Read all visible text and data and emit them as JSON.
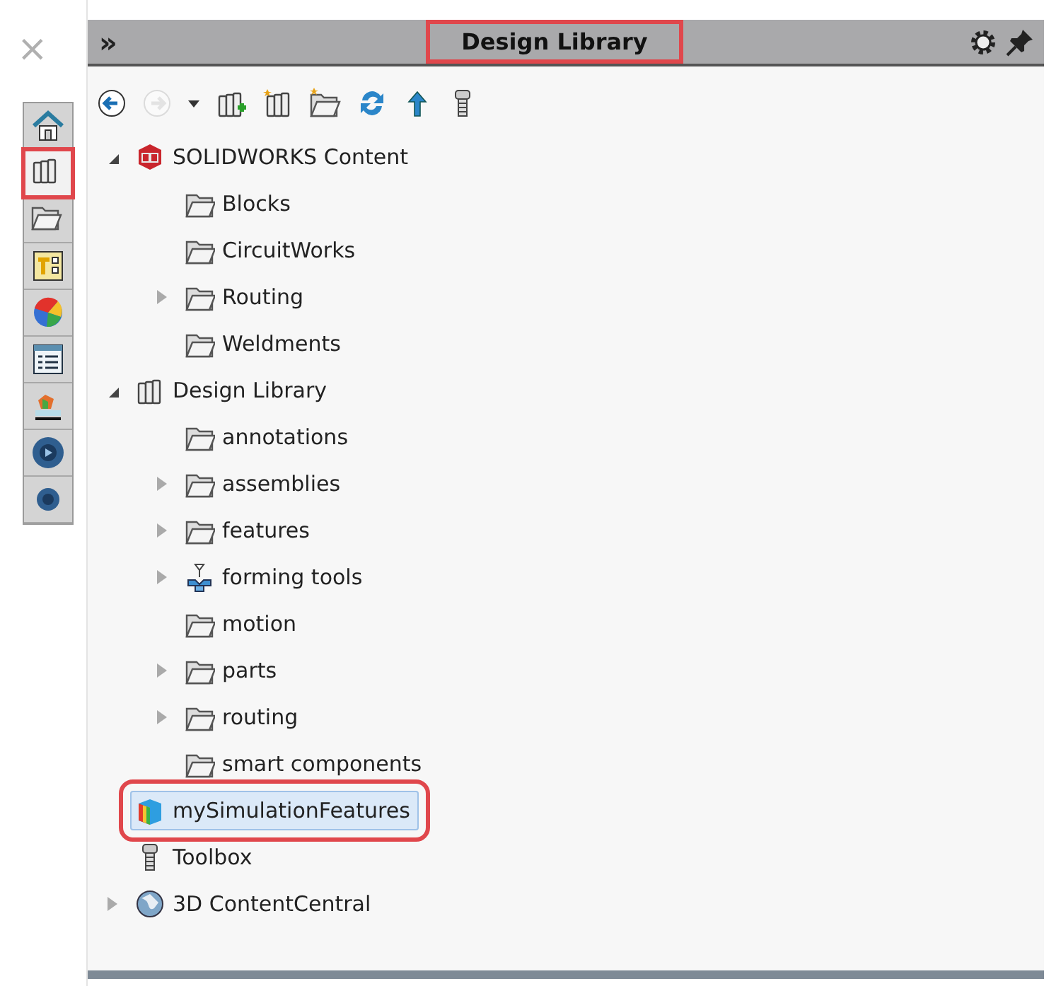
{
  "close_glyph": "×",
  "sidebar_tabs": [
    {
      "kind": "home",
      "selected": false,
      "highlighted": false
    },
    {
      "kind": "library",
      "selected": true,
      "highlighted": true
    },
    {
      "kind": "folder",
      "selected": false,
      "highlighted": false
    },
    {
      "kind": "layout",
      "selected": false,
      "highlighted": false
    },
    {
      "kind": "ball",
      "selected": false,
      "highlighted": false
    },
    {
      "kind": "list",
      "selected": false,
      "highlighted": false
    },
    {
      "kind": "scene",
      "selected": false,
      "highlighted": false
    },
    {
      "kind": "disc",
      "selected": false,
      "highlighted": false
    },
    {
      "kind": "small-disc",
      "selected": false,
      "highlighted": false
    }
  ],
  "panel": {
    "expand_glyph": "»",
    "title": "Design Library",
    "title_highlighted": true,
    "toolbar": [
      {
        "kind": "back",
        "disabled": false
      },
      {
        "kind": "forward",
        "disabled": true
      },
      {
        "kind": "caret",
        "disabled": false
      },
      {
        "kind": "add-library",
        "disabled": false
      },
      {
        "kind": "new-library",
        "disabled": false
      },
      {
        "kind": "new-folder",
        "disabled": false
      },
      {
        "kind": "refresh",
        "disabled": false
      },
      {
        "kind": "up",
        "disabled": false
      },
      {
        "kind": "bolt",
        "disabled": false
      }
    ],
    "tree": [
      {
        "label": "SOLIDWORKS Content",
        "kind": "sw",
        "expanded": true,
        "selected": false,
        "highlighted": false,
        "children": [
          {
            "label": "Blocks",
            "kind": "folder",
            "selected": false,
            "highlighted": false
          },
          {
            "label": "CircuitWorks",
            "kind": "folder",
            "selected": false,
            "highlighted": false
          },
          {
            "label": "Routing",
            "kind": "folder",
            "expanded": false,
            "selected": false,
            "highlighted": false
          },
          {
            "label": "Weldments",
            "kind": "folder",
            "selected": false,
            "highlighted": false
          }
        ]
      },
      {
        "label": "Design Library",
        "kind": "library",
        "expanded": true,
        "selected": false,
        "highlighted": false,
        "children": [
          {
            "label": "annotations",
            "kind": "folder",
            "selected": false,
            "highlighted": false
          },
          {
            "label": "assemblies",
            "kind": "folder",
            "expanded": false,
            "selected": false,
            "highlighted": false
          },
          {
            "label": "features",
            "kind": "folder",
            "expanded": false,
            "selected": false,
            "highlighted": false
          },
          {
            "label": "forming tools",
            "kind": "forming",
            "expanded": false,
            "selected": false,
            "highlighted": false
          },
          {
            "label": "motion",
            "kind": "folder",
            "selected": false,
            "highlighted": false
          },
          {
            "label": "parts",
            "kind": "folder",
            "expanded": false,
            "selected": false,
            "highlighted": false
          },
          {
            "label": "routing",
            "kind": "folder",
            "expanded": false,
            "selected": false,
            "highlighted": false
          },
          {
            "label": "smart components",
            "kind": "folder",
            "selected": false,
            "highlighted": false
          }
        ]
      },
      {
        "label": "mySimulationFeatures",
        "kind": "simulation",
        "selected": true,
        "highlighted": true
      },
      {
        "label": "Toolbox",
        "kind": "toolbox",
        "selected": false,
        "highlighted": false
      },
      {
        "label": "3D ContentCentral",
        "kind": "globe",
        "expanded": false,
        "selected": false,
        "highlighted": false
      }
    ]
  }
}
